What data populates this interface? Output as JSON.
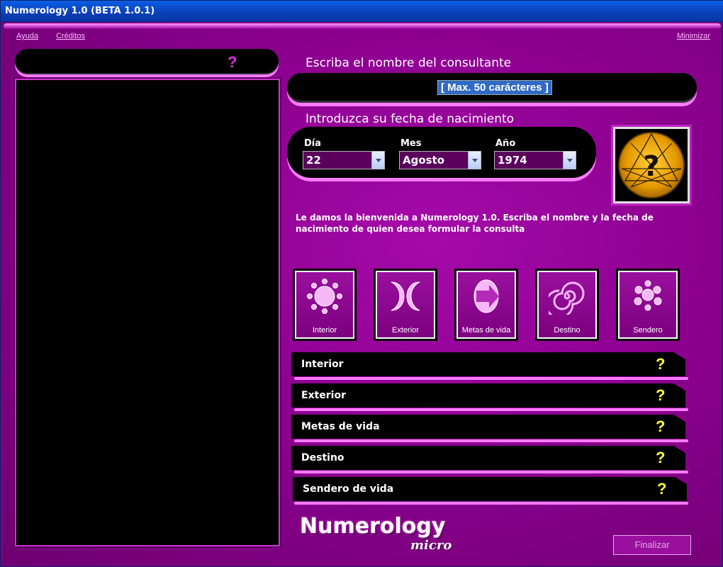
{
  "window": {
    "title": "Numerology 1.0 (BETA 1.0.1)"
  },
  "menu": {
    "help": "Ayuda",
    "credits": "Créditos",
    "minimize": "Minimizar"
  },
  "left_panel": {
    "help_mark": "?"
  },
  "name_section": {
    "heading": "Escriba el nombre del consultante",
    "placeholder": "[ Max. 50 carácteres ]"
  },
  "date_section": {
    "heading": "Introduzca su fecha de nacimiento",
    "day": {
      "label": "Día",
      "value": "22"
    },
    "month": {
      "label": "Mes",
      "value": "Agosto"
    },
    "year": {
      "label": "Año",
      "value": "1974"
    }
  },
  "welcome_text": "Le damos la bienvenida a Numerology 1.0. Escriba el nombre y la fecha de nacimiento de quien desea formular la consulta",
  "categories": [
    {
      "label": "Interior",
      "icon": "sun-icon"
    },
    {
      "label": "Exterior",
      "icon": "crescent-icon"
    },
    {
      "label": "Metas de vida",
      "icon": "arrow-oval-icon"
    },
    {
      "label": "Destino",
      "icon": "spiral-icon"
    },
    {
      "label": "Sendero",
      "icon": "dots-cluster-icon"
    }
  ],
  "result_bars": [
    {
      "label": "Interior",
      "help": "?"
    },
    {
      "label": "Exterior",
      "help": "?"
    },
    {
      "label": "Metas de vida",
      "help": "?"
    },
    {
      "label": "Destino",
      "help": "?"
    },
    {
      "label": "Sendero de vida",
      "help": "?"
    }
  ],
  "logo": {
    "main": "Numerology",
    "sub": "micro"
  },
  "finish_button": "Finalizar",
  "colors": {
    "background": "#8c008f",
    "accent": "#ff7bff",
    "help_mark": "#ffff33"
  }
}
